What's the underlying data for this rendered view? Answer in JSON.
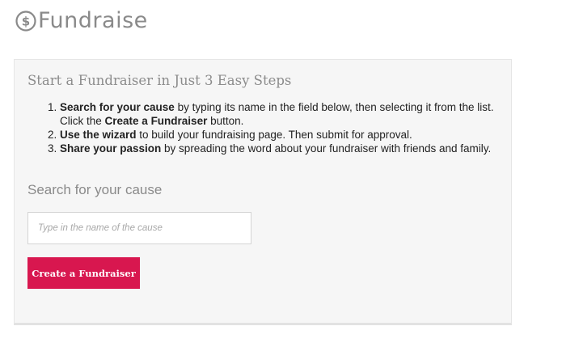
{
  "header": {
    "logo_text": "Fundraise",
    "logo_icon": "dollar-circle-icon"
  },
  "panel": {
    "title": "Start a Fundraiser in Just 3 Easy Steps",
    "steps": [
      {
        "bold": "Search for your cause",
        "text": " by typing its name in the field below, then selecting it from the list. Click the ",
        "bold2": "Create a Fundraiser",
        "text2": " button."
      },
      {
        "bold": "Use the wizard",
        "text": " to build your fundraising page. Then submit for approval."
      },
      {
        "bold": "Share your passion",
        "text": " by spreading the word about your fundraiser with friends and family."
      }
    ],
    "search_heading": "Search for your cause",
    "search_placeholder": "Type in the name of the cause",
    "search_value": "",
    "create_button_label": "Create a Fundraiser"
  },
  "colors": {
    "accent": "#d8174f",
    "heading_gray": "#8a8a8a",
    "panel_bg": "#f6f6f6"
  }
}
